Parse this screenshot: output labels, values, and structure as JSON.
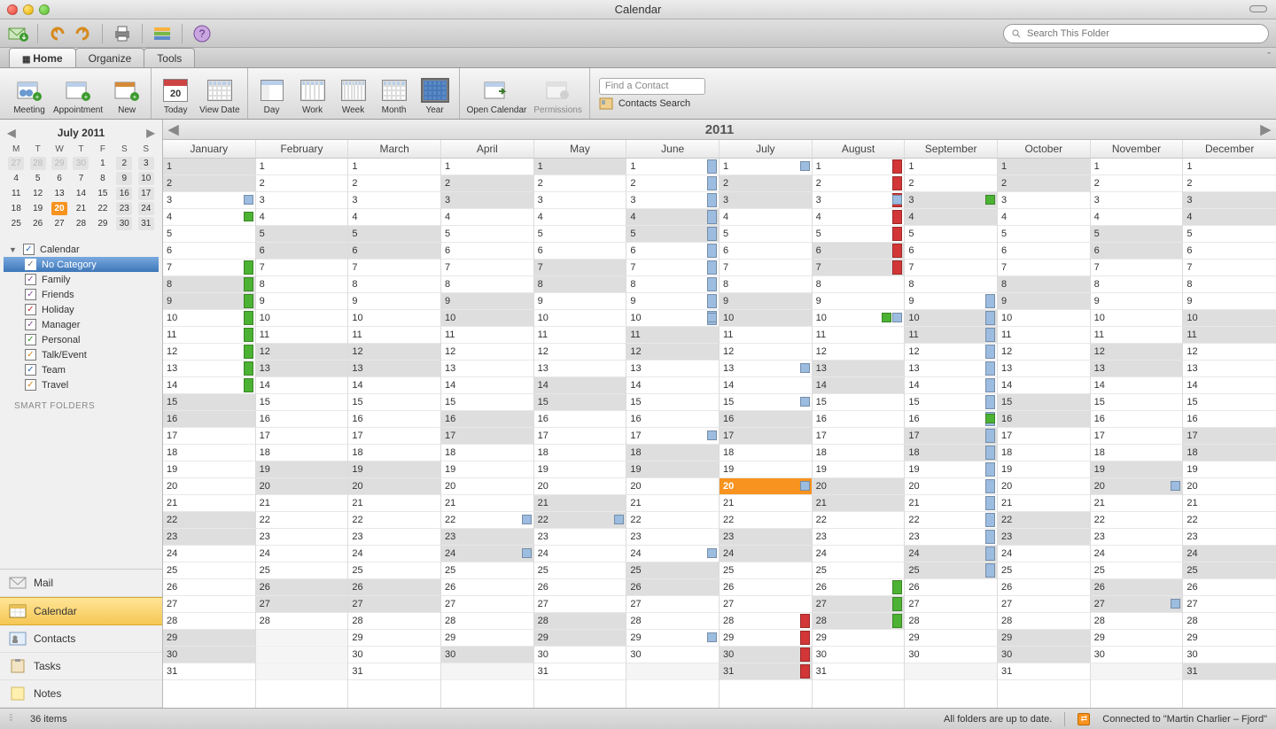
{
  "window": {
    "title": "Calendar"
  },
  "search": {
    "placeholder": "Search This Folder"
  },
  "tabs": {
    "home": "Home",
    "organize": "Organize",
    "tools": "Tools"
  },
  "ribbon": {
    "meeting": "Meeting",
    "appointment": "Appointment",
    "new": "New",
    "today": "Today",
    "viewdate": "View Date",
    "day": "Day",
    "work": "Work",
    "week": "Week",
    "month": "Month",
    "year": "Year",
    "opencal": "Open Calendar",
    "permissions": "Permissions",
    "findcontact": "Find a Contact",
    "contactsearch": "Contacts Search"
  },
  "mini": {
    "title": "July 2011",
    "dow": [
      "M",
      "T",
      "W",
      "T",
      "F",
      "S",
      "S"
    ],
    "cells": [
      {
        "d": "27",
        "dim": true,
        "grey": true
      },
      {
        "d": "28",
        "dim": true,
        "grey": true
      },
      {
        "d": "29",
        "dim": true,
        "grey": true
      },
      {
        "d": "30",
        "dim": true,
        "grey": true
      },
      {
        "d": "1"
      },
      {
        "d": "2",
        "grey": true
      },
      {
        "d": "3",
        "grey": true
      },
      {
        "d": "4"
      },
      {
        "d": "5"
      },
      {
        "d": "6"
      },
      {
        "d": "7"
      },
      {
        "d": "8"
      },
      {
        "d": "9",
        "grey": true
      },
      {
        "d": "10",
        "grey": true
      },
      {
        "d": "11"
      },
      {
        "d": "12"
      },
      {
        "d": "13"
      },
      {
        "d": "14"
      },
      {
        "d": "15"
      },
      {
        "d": "16",
        "grey": true
      },
      {
        "d": "17",
        "grey": true
      },
      {
        "d": "18"
      },
      {
        "d": "19"
      },
      {
        "d": "20",
        "today": true
      },
      {
        "d": "21"
      },
      {
        "d": "22"
      },
      {
        "d": "23",
        "grey": true
      },
      {
        "d": "24",
        "grey": true
      },
      {
        "d": "25"
      },
      {
        "d": "26"
      },
      {
        "d": "27"
      },
      {
        "d": "28"
      },
      {
        "d": "29"
      },
      {
        "d": "30",
        "grey": true
      },
      {
        "d": "31",
        "grey": true
      }
    ]
  },
  "categories": {
    "root": "Calendar",
    "items": [
      {
        "label": "No Category",
        "color": "grey",
        "selected": true
      },
      {
        "label": "Family",
        "color": "purple"
      },
      {
        "label": "Friends",
        "color": "purple"
      },
      {
        "label": "Holiday",
        "color": "red"
      },
      {
        "label": "Manager",
        "color": "purple"
      },
      {
        "label": "Personal",
        "color": "green"
      },
      {
        "label": "Talk/Event",
        "color": "orange"
      },
      {
        "label": "Team",
        "color": "blue"
      },
      {
        "label": "Travel",
        "color": "orange"
      }
    ],
    "smart": "SMART FOLDERS"
  },
  "nav": {
    "mail": "Mail",
    "calendar": "Calendar",
    "contacts": "Contacts",
    "tasks": "Tasks",
    "notes": "Notes"
  },
  "year": {
    "label": "2011",
    "months": [
      "January",
      "February",
      "March",
      "April",
      "May",
      "June",
      "July",
      "August",
      "September",
      "October",
      "November",
      "December"
    ],
    "monthdays": [
      31,
      28,
      31,
      30,
      31,
      30,
      31,
      31,
      30,
      31,
      30,
      31
    ],
    "firstdow": [
      5,
      1,
      1,
      4,
      6,
      2,
      4,
      0,
      3,
      5,
      1,
      3
    ],
    "today": {
      "m": 6,
      "d": 20
    },
    "colors": {
      "blue": "#9cbce0",
      "green": "#4cb233",
      "red": "#d23636",
      "orange": "#f7931e"
    },
    "events": [
      {
        "m": 0,
        "d": 3,
        "dot": [
          "blue"
        ]
      },
      {
        "m": 0,
        "d": 4,
        "dot": [
          "green"
        ]
      },
      {
        "m": 0,
        "d": 7,
        "bar": "green",
        "span": 8
      },
      {
        "m": 3,
        "d": 22,
        "dot": [
          "blue"
        ]
      },
      {
        "m": 3,
        "d": 24,
        "dot": [
          "blue"
        ]
      },
      {
        "m": 4,
        "d": 22,
        "dot": [
          "blue"
        ]
      },
      {
        "m": 5,
        "d": 1,
        "bar": "blue",
        "span": 10
      },
      {
        "m": 5,
        "d": 10,
        "dot": [
          "blue"
        ]
      },
      {
        "m": 5,
        "d": 17,
        "dot": [
          "blue"
        ]
      },
      {
        "m": 5,
        "d": 24,
        "dot": [
          "blue"
        ]
      },
      {
        "m": 5,
        "d": 29,
        "dot": [
          "blue"
        ]
      },
      {
        "m": 6,
        "d": 1,
        "dot": [
          "blue"
        ]
      },
      {
        "m": 6,
        "d": 13,
        "dot": [
          "blue"
        ]
      },
      {
        "m": 6,
        "d": 15,
        "dot": [
          "blue"
        ]
      },
      {
        "m": 6,
        "d": 20,
        "dot": [
          "blue"
        ]
      },
      {
        "m": 6,
        "d": 28,
        "bar": "red",
        "span": 4
      },
      {
        "m": 7,
        "d": 1,
        "bar": "red",
        "span": 7
      },
      {
        "m": 7,
        "d": 3,
        "dot": [
          "blue"
        ]
      },
      {
        "m": 7,
        "d": 10,
        "dot": [
          "green",
          "blue"
        ]
      },
      {
        "m": 7,
        "d": 26,
        "bar": "green",
        "span": 3
      },
      {
        "m": 8,
        "d": 3,
        "dot": [
          "green"
        ]
      },
      {
        "m": 8,
        "d": 9,
        "bar": "blue",
        "span": 17
      },
      {
        "m": 8,
        "d": 16,
        "dot": [
          "green"
        ]
      },
      {
        "m": 10,
        "d": 20,
        "dot": [
          "blue"
        ]
      },
      {
        "m": 10,
        "d": 27,
        "dot": [
          "blue"
        ]
      }
    ]
  },
  "status": {
    "items": "36 items",
    "sync": "All folders are up to date.",
    "conn": "Connected to \"Martin Charlier – Fjord\""
  }
}
